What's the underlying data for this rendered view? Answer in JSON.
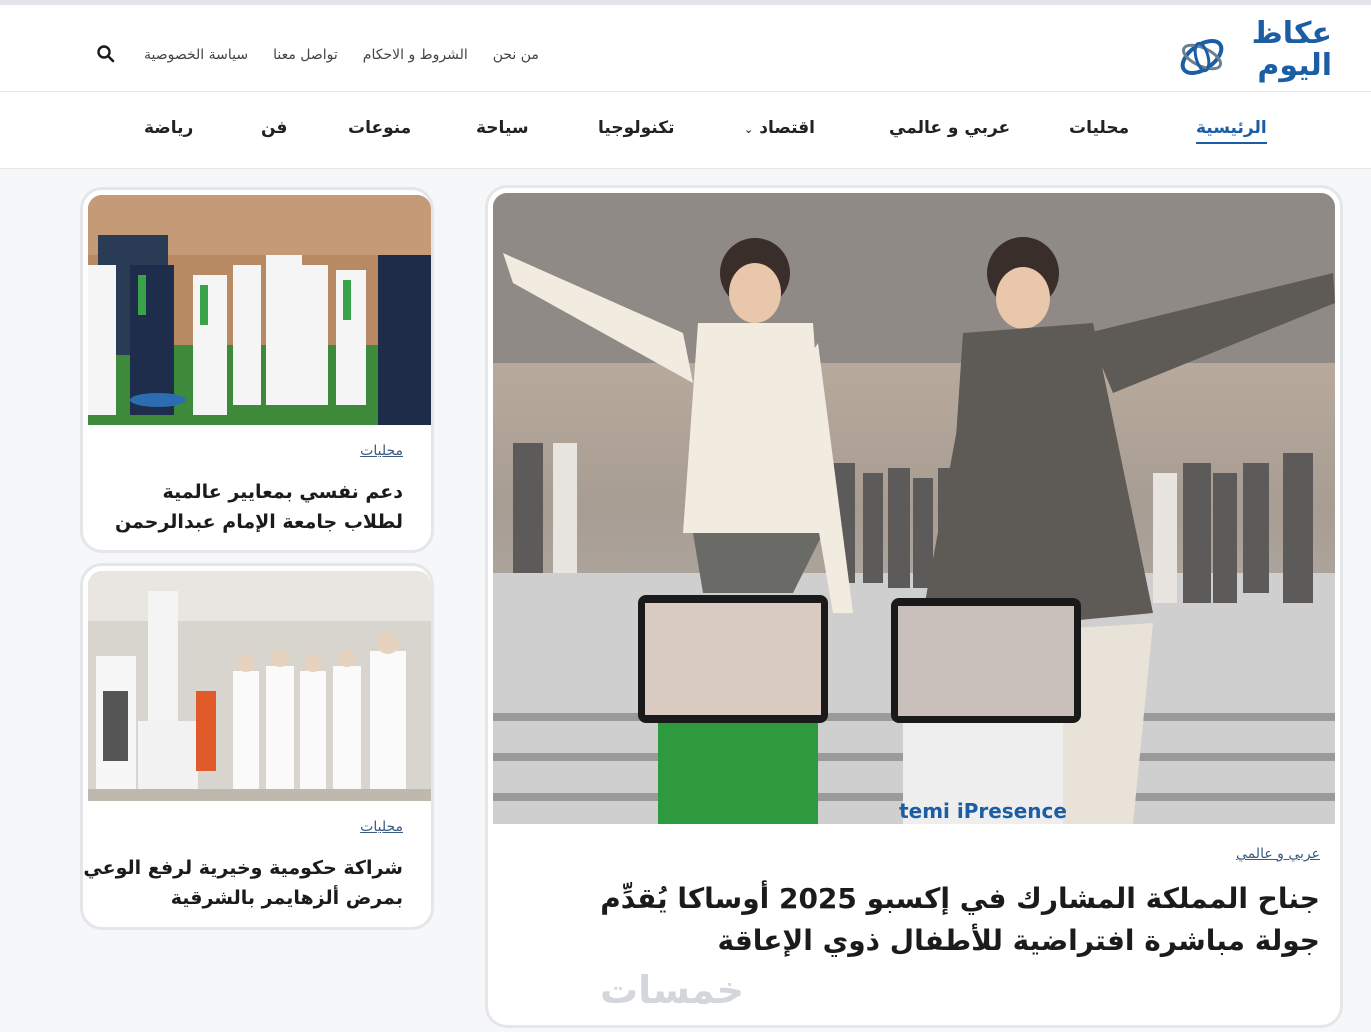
{
  "brand": {
    "logo_line1": "عكاظ",
    "logo_line2": "اليوم",
    "accent_color": "#1c5ea3",
    "logo_icon": "okaz-swirl-logo"
  },
  "utility_nav": {
    "items": [
      "سياسة الخصوصية",
      "تواصل معنا",
      "الشروط و الاحكام",
      "من نحن"
    ],
    "search_icon": "search-icon"
  },
  "main_nav": {
    "items": [
      {
        "label": "الرئيسية",
        "active": true
      },
      {
        "label": "محليات"
      },
      {
        "label": "عربي و عالمي"
      },
      {
        "label": "اقتصاد",
        "has_dropdown": true
      },
      {
        "label": "تكنولوجيا"
      },
      {
        "label": "سياحة"
      },
      {
        "label": "منوعات"
      },
      {
        "label": "فن"
      },
      {
        "label": "رياضة"
      }
    ]
  },
  "featured": {
    "category": "عربي و عالمي",
    "title_line1": "جناح المملكة المشارك في إكسبو 2025 أوساكا يُقدِّم",
    "title_line2": "جولة مباشرة افتراضية للأطفال ذوي الإعاقة",
    "image_caption_text": "temi iPresence"
  },
  "side_articles": [
    {
      "category": "محليات",
      "title_line1": "دعم نفسي بمعايير عالمية",
      "title_line2": "لطلاب جامعة الإمام عبدالرحمن"
    },
    {
      "category": "محليات",
      "title_line1": "شراكة حكومية وخيرية لرفع الوعي",
      "title_line2": "بمرض ألزهايمر بالشرقية"
    }
  ],
  "watermark": "خمسات"
}
